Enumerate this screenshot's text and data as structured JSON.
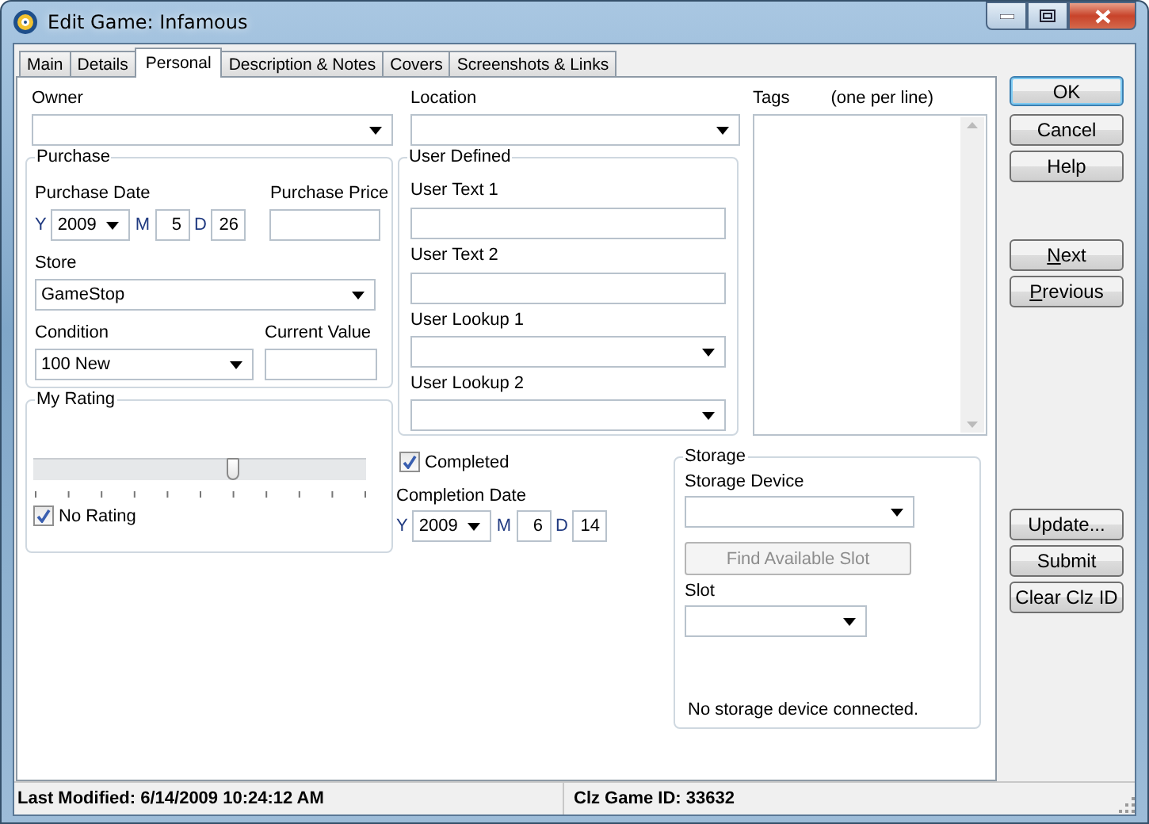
{
  "window": {
    "title": "Edit Game: Infamous"
  },
  "tabs": [
    {
      "label": "Main",
      "selected": false
    },
    {
      "label": "Details",
      "selected": false
    },
    {
      "label": "Personal",
      "selected": true
    },
    {
      "label": "Description & Notes",
      "selected": false
    },
    {
      "label": "Covers",
      "selected": false
    },
    {
      "label": "Screenshots & Links",
      "selected": false
    }
  ],
  "owner": {
    "label": "Owner"
  },
  "purchase": {
    "title": "Purchase",
    "date_label": "Purchase Date",
    "year_prefix": "Y",
    "year": "2009",
    "month_prefix": "M",
    "month": "5",
    "day_prefix": "D",
    "day": "26",
    "price_label": "Purchase Price",
    "store_label": "Store",
    "store": "GameStop",
    "condition_label": "Condition",
    "condition": "100 New",
    "value_label": "Current Value"
  },
  "rating": {
    "title": "My Rating",
    "level": 0.6,
    "no_rating_label": "No Rating",
    "no_rating": true
  },
  "location": {
    "label": "Location"
  },
  "user_defined": {
    "title": "User Defined",
    "fields": [
      {
        "label": "User Text 1",
        "kind": "text"
      },
      {
        "label": "User Text 2",
        "kind": "text"
      },
      {
        "label": "User Lookup 1",
        "kind": "combo"
      },
      {
        "label": "User Lookup 2",
        "kind": "combo"
      }
    ]
  },
  "tags": {
    "label": "Tags",
    "hint": "(one per line)"
  },
  "completed": {
    "label": "Completed",
    "checked": true
  },
  "completion": {
    "label": "Completion Date",
    "year_prefix": "Y",
    "year": "2009",
    "month_prefix": "M",
    "month": "6",
    "day_prefix": "D",
    "day": "14"
  },
  "storage": {
    "title": "Storage",
    "device_label": "Storage Device",
    "find_button": {
      "label": "Find Available Slot",
      "disabled": true
    },
    "slot_label": "Slot",
    "message": "No storage device connected."
  },
  "button_groups": [
    [
      {
        "label": "OK",
        "default": true,
        "underline_first": false
      },
      {
        "label": "Cancel",
        "default": false,
        "underline_first": false
      },
      {
        "label": "Help",
        "default": false,
        "underline_first": false
      }
    ],
    [
      {
        "label": "Next",
        "default": false,
        "underline_first": true
      },
      {
        "label": "Previous",
        "default": false,
        "underline_first": true
      }
    ],
    [
      {
        "label": "Update...",
        "default": false,
        "underline_first": false
      },
      {
        "label": "Submit",
        "default": false,
        "underline_first": false
      },
      {
        "label": "Clear Clz ID",
        "default": false,
        "underline_first": false
      }
    ]
  ],
  "status_bar": [
    {
      "text": "Last Modified: 6/14/2009 10:24:12 AM"
    },
    {
      "text": "Clz Game ID: 33632"
    }
  ]
}
